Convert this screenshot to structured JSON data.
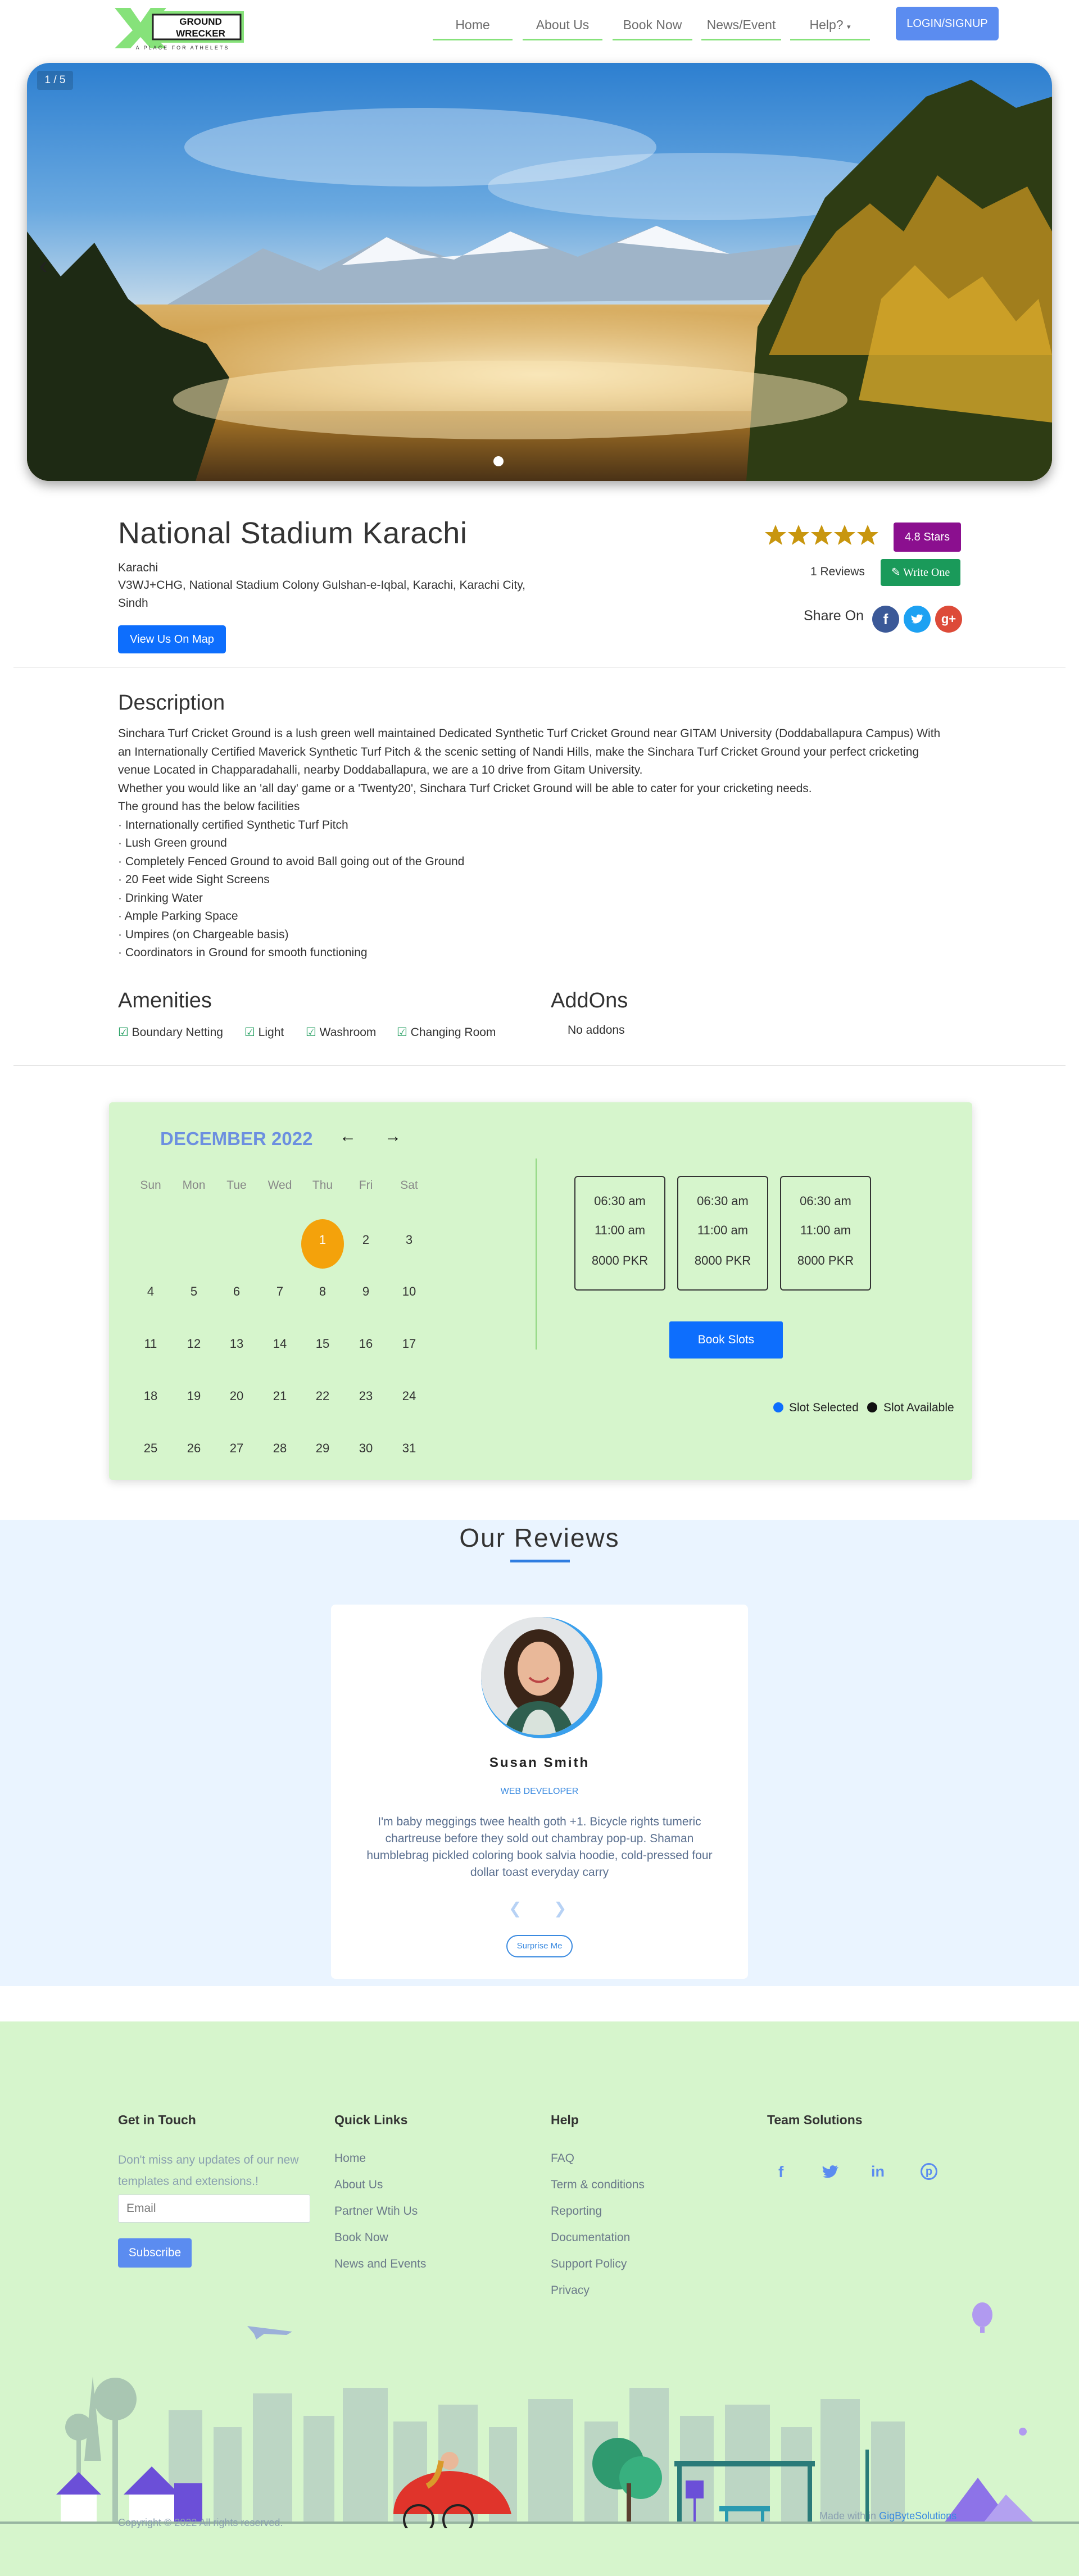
{
  "header": {
    "logo_text_1": "GROUND",
    "logo_text_2": "WRECKER",
    "logo_tagline": "A PLACE FOR ATHELETS",
    "nav": [
      "Home",
      "About Us",
      "Book Now",
      "News/Event",
      "Help?"
    ],
    "login_label": "LOGIN/SIGNUP"
  },
  "hero": {
    "counter": "1 / 5",
    "prev_glyph": "‹",
    "active_slide": 1,
    "total_slides": 5
  },
  "venue": {
    "title": "National Stadium Karachi",
    "city": "Karachi",
    "address_line1": "V3WJ+CHG, National Stadium Colony Gulshan-e-Iqbal, Karachi, Karachi City,",
    "address_line2": "Sindh",
    "map_button": "View Us On Map",
    "rating_stars": 5,
    "rating_badge": "4.8 Stars",
    "reviews_count": "1 Reviews",
    "write_button": "Write One",
    "share_label": "Share On"
  },
  "description": {
    "heading": "Description",
    "lines": [
      "Sinchara Turf Cricket Ground is a lush green well maintained Dedicated Synthetic Turf Cricket Ground near GITAM University (Doddaballapura Campus) With",
      "an Internationally Certified Maverick Synthetic Turf Pitch & the scenic setting of Nandi Hills, make the Sinchara Turf Cricket Ground your perfect cricketing",
      "venue Located in Chapparadahalli, nearby Doddaballapura, we are a 10 drive from Gitam University.",
      "Whether you would like an 'all day' game or a 'Twenty20', Sinchara Turf Cricket Ground will be able to cater for your cricketing needs.",
      "The ground has the below facilities",
      "· Internationally certified Synthetic Turf Pitch",
      "· Lush Green ground",
      "· Completely Fenced Ground to avoid Ball going out of the Ground",
      "· 20 Feet wide Sight Screens",
      "· Drinking Water",
      "· Ample Parking Space",
      "· Umpires (on Chargeable basis)",
      "· Coordinators in Ground for smooth functioning"
    ]
  },
  "amenities": {
    "heading": "Amenities",
    "items": [
      "Boundary Netting",
      "Light",
      "Washroom",
      "Changing Room"
    ],
    "addons_heading": "AddOns",
    "addons_text": "No addons"
  },
  "calendar": {
    "month": "DECEMBER 2022",
    "prev_glyph": "←",
    "next_glyph": "→",
    "weekdays": [
      "Sun",
      "Mon",
      "Tue",
      "Wed",
      "Thu",
      "Fri",
      "Sat"
    ],
    "first_weekday": 4,
    "days_in_month": 31,
    "selected_day": "1",
    "slots": [
      {
        "start": "06:30 am",
        "end": "11:00 am",
        "price": "8000 PKR"
      },
      {
        "start": "06:30 am",
        "end": "11:00 am",
        "price": "8000 PKR"
      },
      {
        "start": "06:30 am",
        "end": "11:00 am",
        "price": "8000 PKR"
      }
    ],
    "book_button": "Book Slots",
    "legend_selected": "Slot Selected",
    "legend_available": "Slot Available"
  },
  "reviews": {
    "heading": "Our Reviews",
    "name": "Susan Smith",
    "role": "WEB DEVELOPER",
    "text_lines": [
      "I'm baby meggings twee health goth +1. Bicycle rights tumeric",
      "chartreuse before they sold out chambray pop-up. Shaman",
      "humblebrag pickled coloring book salvia hoodie, cold-pressed four",
      "dollar toast everyday carry"
    ],
    "prev_glyph": "❮",
    "next_glyph": "❯",
    "surprise_button": "Surprise Me"
  },
  "footer": {
    "get_in_touch": {
      "heading": "Get in Touch",
      "text_lines": [
        "Don't miss any updates of our new",
        "templates and extensions.!"
      ],
      "email_placeholder": "Email",
      "subscribe": "Subscribe"
    },
    "quick_links": {
      "heading": "Quick Links",
      "items": [
        "Home",
        "About Us",
        "Partner Wtih Us",
        "Book Now",
        "News and Events"
      ]
    },
    "help": {
      "heading": "Help",
      "items": [
        "FAQ",
        "Term & conditions",
        "Reporting",
        "Documentation",
        "Support Policy",
        "Privacy"
      ]
    },
    "team": {
      "heading": "Team Solutions",
      "socials": [
        "facebook-icon",
        "twitter-icon",
        "linkedin-icon",
        "pinterest-icon"
      ]
    },
    "copyright": "Copyright © 2022 All rights reserved.",
    "made_with": "Made with in",
    "made_with_link": "GigByteSolutions"
  },
  "colors": {
    "accent_green": "#86e27a",
    "brand_blue": "#0d6efd",
    "badge_purple": "#8b0f8f",
    "badge_green": "#1a9a5a",
    "calendar_bg": "#d6f5cc",
    "selected_day": "#f4a20b"
  }
}
